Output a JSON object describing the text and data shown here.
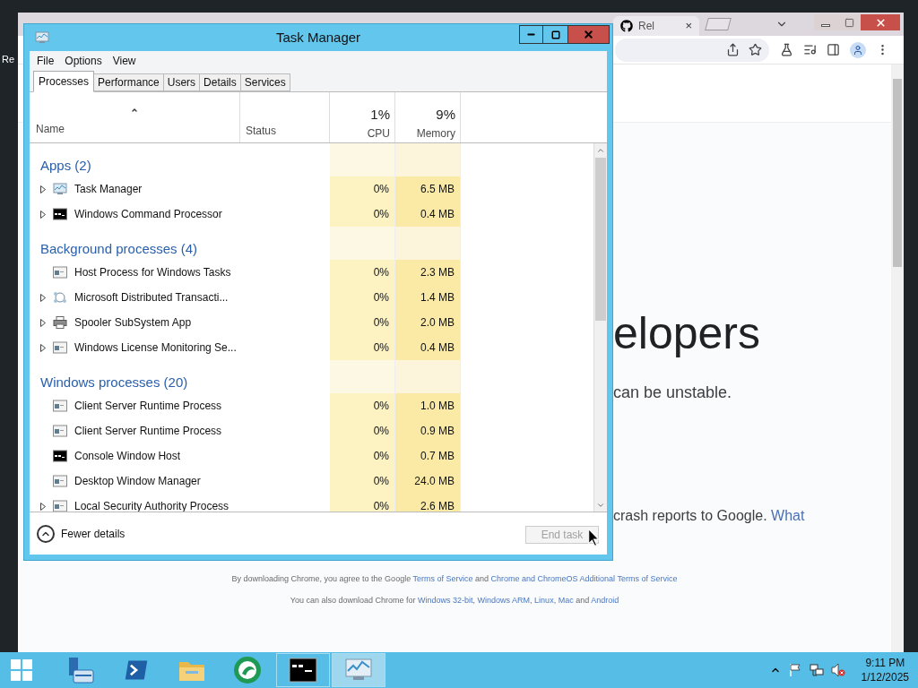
{
  "desktop": {
    "icon_label": "Re"
  },
  "browser": {
    "tab": {
      "title": "Rel",
      "close": "×"
    },
    "heading": "elopers",
    "subtitle": "can be unstable.",
    "crash": {
      "text": "crash reports to Google.",
      "link": "What"
    },
    "footer_lines": [
      [
        {
          "text": "By downloading Chrome, you agree to the Google ",
          "link": false
        },
        {
          "text": "Terms of Service",
          "link": true
        },
        {
          "text": " and ",
          "link": false
        },
        {
          "text": "Chrome and ChromeOS Additional Terms of Service",
          "link": true
        }
      ],
      [
        {
          "text": "You can also download Chrome for ",
          "link": false
        },
        {
          "text": "Windows 32-bit",
          "link": true
        },
        {
          "text": ", ",
          "link": false
        },
        {
          "text": "Windows ARM",
          "link": true
        },
        {
          "text": ", ",
          "link": false
        },
        {
          "text": "Linux",
          "link": true
        },
        {
          "text": ", ",
          "link": false
        },
        {
          "text": "Mac",
          "link": true
        },
        {
          "text": " and ",
          "link": false
        },
        {
          "text": "Android",
          "link": true
        }
      ]
    ]
  },
  "task_manager": {
    "title": "Task Manager",
    "menu": [
      "File",
      "Options",
      "View"
    ],
    "tabs": [
      {
        "label": "Processes",
        "selected": true
      },
      {
        "label": "Performance",
        "selected": false
      },
      {
        "label": "Users",
        "selected": false
      },
      {
        "label": "Details",
        "selected": false
      },
      {
        "label": "Services",
        "selected": false
      }
    ],
    "columns": {
      "name": "Name",
      "status": "Status",
      "cpu_total": "1%",
      "cpu": "CPU",
      "memory_total": "9%",
      "memory": "Memory"
    },
    "groups": [
      {
        "title": "Apps (2)",
        "rows": [
          {
            "name": "Task Manager",
            "kind": "monitor",
            "expandable": true,
            "cpu": "0%",
            "memory": "6.5 MB"
          },
          {
            "name": "Windows Command Processor",
            "kind": "console",
            "expandable": true,
            "cpu": "0%",
            "memory": "0.4 MB"
          }
        ]
      },
      {
        "title": "Background processes (4)",
        "rows": [
          {
            "name": "Host Process for Windows Tasks",
            "kind": "service",
            "expandable": false,
            "cpu": "0%",
            "memory": "2.3 MB"
          },
          {
            "name": "Microsoft Distributed Transacti...",
            "kind": "network",
            "expandable": true,
            "cpu": "0%",
            "memory": "1.4 MB"
          },
          {
            "name": "Spooler SubSystem App",
            "kind": "printer",
            "expandable": true,
            "cpu": "0%",
            "memory": "2.0 MB"
          },
          {
            "name": "Windows License Monitoring Se...",
            "kind": "service",
            "expandable": true,
            "cpu": "0%",
            "memory": "0.4 MB"
          }
        ]
      },
      {
        "title": "Windows processes (20)",
        "rows": [
          {
            "name": "Client Server Runtime Process",
            "kind": "service",
            "expandable": false,
            "cpu": "0%",
            "memory": "1.0 MB"
          },
          {
            "name": "Client Server Runtime Process",
            "kind": "service",
            "expandable": false,
            "cpu": "0%",
            "memory": "0.9 MB"
          },
          {
            "name": "Console Window Host",
            "kind": "console",
            "expandable": false,
            "cpu": "0%",
            "memory": "0.7 MB"
          },
          {
            "name": "Desktop Window Manager",
            "kind": "service",
            "expandable": false,
            "cpu": "0%",
            "memory": "24.0 MB"
          },
          {
            "name": "Local Security Authority Process",
            "kind": "service",
            "expandable": true,
            "cpu": "0%",
            "memory": "2.6 MB"
          }
        ]
      }
    ],
    "footer": {
      "fewer_details": "Fewer details",
      "end_task": {
        "label": "End task",
        "disabled": true
      }
    }
  },
  "taskbar": {
    "apps": [
      {
        "kind": "server",
        "running": false,
        "selected": false
      },
      {
        "kind": "shell",
        "running": false,
        "selected": false
      },
      {
        "kind": "folder",
        "running": false,
        "selected": false
      },
      {
        "kind": "green",
        "running": false,
        "selected": false
      },
      {
        "kind": "console",
        "running": true,
        "selected": false
      },
      {
        "kind": "monitor",
        "running": true,
        "selected": true
      }
    ],
    "time": "9:11 PM",
    "date": "1/12/2025"
  }
}
